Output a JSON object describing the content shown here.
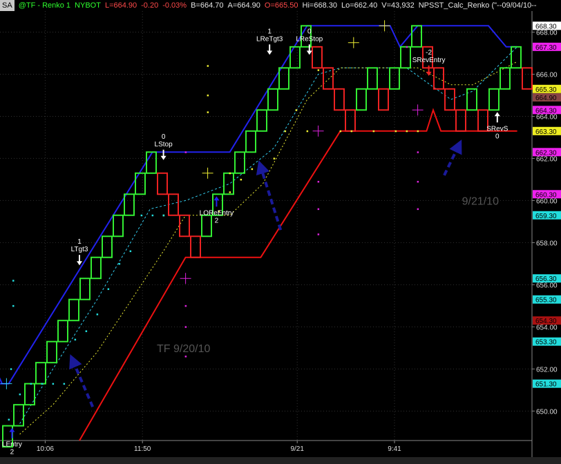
{
  "header": {
    "badge": "SA",
    "symbol": "@TF - Renko 1",
    "exchange": "NYBOT",
    "last": "L=664.90",
    "change": "-0.20",
    "pct": "-0.03%",
    "bid": "B=664.70",
    "ask": "A=664.90",
    "open": "O=665.50",
    "high": "Hi=668.30",
    "low": "Lo=662.40",
    "volume": "V=43,932",
    "study": "NPSST_Calc_Renko (\"--09/04/10--"
  },
  "colors": {
    "up_brick": "#33ee33",
    "down_brick": "#ee2222",
    "upper_line": "#2222ee",
    "stop_line": "#ee1111",
    "dotted_fast": "#33ccee",
    "dotted_slow": "#eeee33",
    "dots_mid": "#eeee33",
    "dots_cyan": "#22dddd",
    "dots_magenta": "#dd22dd",
    "arrow": "#1a1a9a"
  },
  "chart_data": {
    "type": "renko",
    "brick_size": 1,
    "ylim": [
      648.6,
      669.0
    ],
    "y_ticks": [
      650.0,
      652.0,
      654.0,
      656.0,
      658.0,
      660.0,
      662.0,
      664.0,
      666.0,
      668.0
    ],
    "y_tick_labels": [
      "650.00",
      "652.00",
      "654.00",
      "656.00",
      "658.00",
      "660.00",
      "662.00",
      "664.00",
      "666.00",
      "668.00"
    ],
    "x_tick_labels": [
      {
        "brick": 3.9,
        "label": "10:06"
      },
      {
        "brick": 12.7,
        "label": "11:50"
      },
      {
        "brick": 26.7,
        "label": "9/21"
      },
      {
        "brick": 35.5,
        "label": "9:41"
      }
    ],
    "bricks": [
      {
        "d": "up",
        "low": 648.3,
        "high": 649.3
      },
      {
        "d": "up",
        "low": 649.3,
        "high": 650.3
      },
      {
        "d": "up",
        "low": 650.3,
        "high": 651.3
      },
      {
        "d": "up",
        "low": 651.3,
        "high": 652.3
      },
      {
        "d": "up",
        "low": 652.3,
        "high": 653.3
      },
      {
        "d": "up",
        "low": 653.3,
        "high": 654.3
      },
      {
        "d": "up",
        "low": 654.3,
        "high": 655.3
      },
      {
        "d": "up",
        "low": 655.3,
        "high": 656.3
      },
      {
        "d": "up",
        "low": 656.3,
        "high": 657.3
      },
      {
        "d": "up",
        "low": 657.3,
        "high": 658.3
      },
      {
        "d": "up",
        "low": 658.3,
        "high": 659.3
      },
      {
        "d": "up",
        "low": 659.3,
        "high": 660.3
      },
      {
        "d": "up",
        "low": 660.3,
        "high": 661.3
      },
      {
        "d": "up",
        "low": 661.3,
        "high": 662.3
      },
      {
        "d": "down",
        "low": 660.3,
        "high": 661.3
      },
      {
        "d": "down",
        "low": 659.3,
        "high": 660.3
      },
      {
        "d": "down",
        "low": 658.3,
        "high": 659.3
      },
      {
        "d": "down",
        "low": 657.3,
        "high": 658.3
      },
      {
        "d": "up",
        "low": 658.3,
        "high": 659.3
      },
      {
        "d": "up",
        "low": 659.3,
        "high": 660.3
      },
      {
        "d": "up",
        "low": 660.3,
        "high": 661.3
      },
      {
        "d": "up",
        "low": 661.3,
        "high": 662.3
      },
      {
        "d": "up",
        "low": 662.3,
        "high": 663.3
      },
      {
        "d": "up",
        "low": 663.3,
        "high": 664.3
      },
      {
        "d": "up",
        "low": 664.3,
        "high": 665.3
      },
      {
        "d": "up",
        "low": 665.3,
        "high": 666.3
      },
      {
        "d": "up",
        "low": 666.3,
        "high": 667.3
      },
      {
        "d": "up",
        "low": 667.3,
        "high": 668.3
      },
      {
        "d": "down",
        "low": 666.3,
        "high": 667.3
      },
      {
        "d": "down",
        "low": 665.3,
        "high": 666.3
      },
      {
        "d": "down",
        "low": 664.3,
        "high": 665.3
      },
      {
        "d": "down",
        "low": 663.3,
        "high": 664.3
      },
      {
        "d": "up",
        "low": 664.3,
        "high": 665.3
      },
      {
        "d": "up",
        "low": 665.3,
        "high": 666.3
      },
      {
        "d": "down",
        "low": 664.3,
        "high": 665.3
      },
      {
        "d": "up",
        "low": 665.3,
        "high": 666.3
      },
      {
        "d": "up",
        "low": 666.3,
        "high": 667.3
      },
      {
        "d": "up",
        "low": 667.3,
        "high": 668.3
      },
      {
        "d": "down",
        "low": 666.3,
        "high": 667.3
      },
      {
        "d": "down",
        "low": 665.3,
        "high": 666.3
      },
      {
        "d": "down",
        "low": 664.3,
        "high": 665.3
      },
      {
        "d": "down",
        "low": 663.3,
        "high": 664.3
      },
      {
        "d": "up",
        "low": 664.3,
        "high": 665.3
      },
      {
        "d": "down",
        "low": 663.3,
        "high": 664.3
      },
      {
        "d": "up",
        "low": 664.3,
        "high": 665.3
      },
      {
        "d": "up",
        "low": 665.3,
        "high": 666.3
      },
      {
        "d": "up",
        "low": 666.3,
        "high": 667.3
      },
      {
        "d": "down",
        "low": 665.3,
        "high": 666.3
      }
    ],
    "upper_line": [
      [
        -0.5,
        651.3
      ],
      [
        0.6,
        651.3
      ],
      [
        13.6,
        662.3
      ],
      [
        20.6,
        662.3
      ],
      [
        27.6,
        668.3
      ],
      [
        35.1,
        668.3
      ],
      [
        36.0,
        667.3
      ],
      [
        37.6,
        668.3
      ],
      [
        44.0,
        668.3
      ],
      [
        45.6,
        667.3
      ],
      [
        46.6,
        667.3
      ]
    ],
    "stop_line": [
      [
        7.0,
        648.6
      ],
      [
        16.6,
        657.3
      ],
      [
        23.4,
        657.3
      ],
      [
        30.6,
        663.3
      ],
      [
        38.4,
        663.3
      ],
      [
        39.0,
        664.3
      ],
      [
        39.7,
        663.3
      ],
      [
        46.6,
        663.3
      ]
    ],
    "upper_tail": [
      [
        -1.7,
        653.3
      ],
      [
        0.0,
        651.3
      ]
    ],
    "dotted_fast": [
      [
        1.6,
        649.4
      ],
      [
        4.6,
        652.0
      ],
      [
        8.6,
        655.3
      ],
      [
        13.4,
        659.6
      ],
      [
        16.6,
        660.0
      ],
      [
        20.6,
        660.8
      ],
      [
        24.6,
        662.5
      ],
      [
        28.6,
        666.0
      ],
      [
        30.6,
        666.3
      ],
      [
        34.6,
        666.3
      ],
      [
        36.6,
        666.3
      ],
      [
        40.6,
        664.8
      ],
      [
        42.6,
        665.2
      ],
      [
        46.6,
        667.3
      ]
    ],
    "dotted_slow": [
      [
        1.6,
        648.9
      ],
      [
        4.6,
        650.3
      ],
      [
        8.6,
        652.8
      ],
      [
        14.6,
        657.6
      ],
      [
        16.6,
        659.3
      ],
      [
        20.6,
        659.3
      ],
      [
        23.6,
        660.8
      ],
      [
        27.6,
        664.8
      ],
      [
        30.6,
        666.3
      ],
      [
        34.6,
        666.3
      ],
      [
        37.6,
        666.3
      ],
      [
        40.6,
        665.5
      ],
      [
        42.6,
        665.5
      ],
      [
        46.6,
        666.6
      ]
    ],
    "dots_yellow": [
      [
        14.6,
        659.3
      ],
      [
        18.6,
        664.2
      ],
      [
        18.6,
        665.0
      ],
      [
        18.6,
        666.4
      ],
      [
        20.6,
        661.3
      ],
      [
        21.6,
        661.0
      ],
      [
        22.6,
        661.5
      ],
      [
        23.6,
        661.5
      ],
      [
        24.6,
        662.0
      ],
      [
        25.6,
        663.3
      ],
      [
        26.6,
        664.3
      ],
      [
        27.6,
        663.3
      ],
      [
        28.6,
        666.2
      ],
      [
        30.6,
        663.3
      ],
      [
        31.6,
        663.3
      ],
      [
        33.6,
        663.3
      ],
      [
        35.6,
        663.3
      ],
      [
        36.6,
        663.3
      ],
      [
        37.6,
        663.3
      ],
      [
        20.6,
        660.4
      ],
      [
        19.6,
        659.5
      ]
    ],
    "dots_cyan": [
      [
        0.6,
        649.6
      ],
      [
        1.6,
        650.8
      ],
      [
        2.6,
        651.3
      ],
      [
        3.6,
        651.3
      ],
      [
        4.6,
        651.3
      ],
      [
        5.6,
        651.3
      ],
      [
        6.6,
        653.4
      ],
      [
        7.6,
        653.8
      ],
      [
        8.6,
        654.6
      ],
      [
        9.6,
        655.8
      ],
      [
        10.6,
        657.0
      ],
      [
        11.6,
        657.6
      ],
      [
        12.6,
        659.3
      ],
      [
        13.6,
        659.3
      ],
      [
        14.6,
        659.3
      ],
      [
        1.0,
        655.0
      ],
      [
        1.0,
        656.2
      ],
      [
        0.8,
        652.0
      ]
    ],
    "dots_magenta": [
      [
        16.6,
        652.6
      ],
      [
        16.6,
        654.0
      ],
      [
        16.6,
        655.0
      ],
      [
        16.6,
        662.3
      ],
      [
        28.6,
        658.4
      ],
      [
        28.6,
        659.6
      ],
      [
        28.6,
        660.9
      ],
      [
        37.6,
        659.6
      ],
      [
        37.6,
        660.9
      ],
      [
        37.6,
        662.3
      ],
      [
        36.6,
        667.3
      ]
    ],
    "crosses": [
      {
        "brick": 0.4,
        "value": 651.3,
        "color": "#33ccee"
      },
      {
        "brick": 16.6,
        "value": 656.3,
        "color": "#dd22dd"
      },
      {
        "brick": 18.6,
        "value": 661.3,
        "color": "#eeee33"
      },
      {
        "brick": 28.6,
        "value": 663.3,
        "color": "#dd22dd"
      },
      {
        "brick": 31.8,
        "value": 667.5,
        "color": "#eeee33"
      },
      {
        "brick": 34.6,
        "value": 668.3,
        "color": "#eeee33"
      },
      {
        "brick": 37.6,
        "value": 664.3,
        "color": "#dd22dd"
      }
    ],
    "dashed_arrows": [
      {
        "from": [
          8.2,
          650.2
        ],
        "to": [
          6.4,
          652.4
        ]
      },
      {
        "from": [
          25.2,
          658.6
        ],
        "to": [
          23.4,
          661.6
        ]
      },
      {
        "from": [
          40.0,
          661.2
        ],
        "to": [
          41.3,
          662.6
        ]
      }
    ],
    "annotations": [
      {
        "brick": 0.9,
        "value": 649.3,
        "lines": [
          "LEntry",
          "2"
        ],
        "arrow": "up",
        "arrow_color": "#2222ee"
      },
      {
        "brick": 7.0,
        "value": 656.3,
        "lines": [
          "1",
          "LTgt3"
        ],
        "arrow": "down",
        "arrow_color": "#ffffff"
      },
      {
        "brick": 14.6,
        "value": 661.3,
        "lines": [
          "0",
          "LStop"
        ],
        "arrow": "down",
        "arrow_color": "#ffffff"
      },
      {
        "brick": 19.4,
        "value": 660.3,
        "lines": [
          "LOReEntry",
          "2"
        ],
        "arrow": "up",
        "arrow_color": "#2222ee"
      },
      {
        "brick": 24.2,
        "value": 666.3,
        "lines": [
          "1",
          "LReTgt3"
        ],
        "arrow": "down",
        "arrow_color": "#ffffff"
      },
      {
        "brick": 27.8,
        "value": 666.3,
        "lines": [
          "0",
          "LReStop"
        ],
        "arrow": "down",
        "arrow_color": "#ffffff"
      },
      {
        "brick": 38.6,
        "value": 665.3,
        "lines": [
          "-2",
          "SRevEntry"
        ],
        "arrow": "down",
        "arrow_color": "#ee2222"
      },
      {
        "brick": 44.8,
        "value": 664.3,
        "lines": [
          "SRevS",
          "0"
        ],
        "arrow": "up",
        "arrow_color": "#ffffff"
      }
    ],
    "watermarks": [
      {
        "brick": 14.0,
        "value": 652.8,
        "text": "TF 9/20/10"
      },
      {
        "brick": 41.6,
        "value": 659.8,
        "text": "9/21/10"
      }
    ],
    "price_labels": [
      {
        "value": 668.3,
        "text": "668.30",
        "bg": "#ffffff",
        "fg": "#000000"
      },
      {
        "value": 667.3,
        "text": "667.30",
        "bg": "#ee22ee",
        "fg": "#000000"
      },
      {
        "value": 665.3,
        "text": "665.30",
        "bg": "#eeee22",
        "fg": "#000000"
      },
      {
        "value": 664.9,
        "text": "664.90",
        "bg": "#884444",
        "fg": "#000000"
      },
      {
        "value": 664.3,
        "text": "664.30",
        "bg": "#ee22ee",
        "fg": "#000000"
      },
      {
        "value": 663.3,
        "text": "663.30",
        "bg": "#eeee22",
        "fg": "#000000"
      },
      {
        "value": 662.3,
        "text": "662.30",
        "bg": "#ee22ee",
        "fg": "#000000"
      },
      {
        "value": 660.3,
        "text": "660.30",
        "bg": "#ee22ee",
        "fg": "#000000"
      },
      {
        "value": 659.3,
        "text": "659.30",
        "bg": "#22dddd",
        "fg": "#000000"
      },
      {
        "value": 656.3,
        "text": "656.30",
        "bg": "#22dddd",
        "fg": "#000000"
      },
      {
        "value": 655.3,
        "text": "655.30",
        "bg": "#22dddd",
        "fg": "#000000"
      },
      {
        "value": 654.3,
        "text": "654.30",
        "bg": "#aa1111",
        "fg": "#000000"
      },
      {
        "value": 653.3,
        "text": "653.30",
        "bg": "#22dddd",
        "fg": "#000000"
      },
      {
        "value": 651.3,
        "text": "651.30",
        "bg": "#22dddd",
        "fg": "#000000"
      }
    ]
  }
}
